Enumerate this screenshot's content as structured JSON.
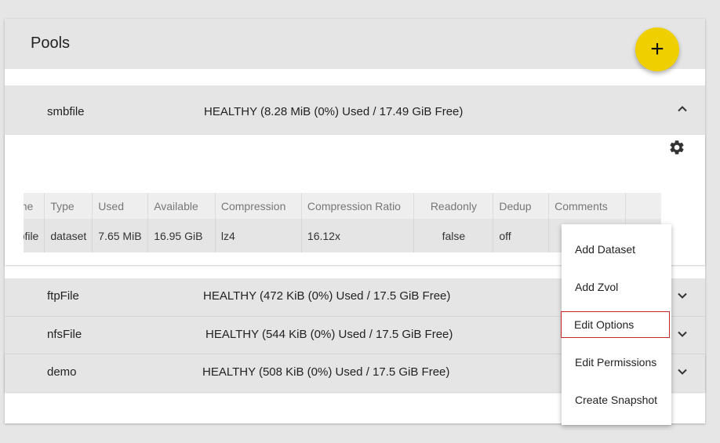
{
  "page": {
    "title": "Pools"
  },
  "fab": {
    "label": "+"
  },
  "pools": [
    {
      "name": "smbfile",
      "status": "HEALTHY (8.28 MiB (0%) Used / 17.49 GiB Free)",
      "expanded": true
    },
    {
      "name": "ftpFile",
      "status": "HEALTHY (472 KiB (0%) Used / 17.5 GiB Free)",
      "expanded": false
    },
    {
      "name": "nfsFile",
      "status": "HEALTHY (544 KiB (0%) Used / 17.5 GiB Free)",
      "expanded": false
    },
    {
      "name": "demo",
      "status": "HEALTHY (508 KiB (0%) Used / 17.5 GiB Free)",
      "expanded": false
    }
  ],
  "table": {
    "headers": [
      "Name",
      "Type",
      "Used",
      "Available",
      "Compression",
      "Compression Ratio",
      "Readonly",
      "Dedup",
      "Comments"
    ],
    "rows": [
      [
        "smbfile",
        "dataset",
        "7.65 MiB",
        "16.95 GiB",
        "lz4",
        "16.12x",
        "false",
        "off",
        ""
      ]
    ]
  },
  "menu": {
    "items": [
      "Add Dataset",
      "Add Zvol",
      "Edit Options",
      "Edit Permissions",
      "Create Snapshot"
    ],
    "focused": "Edit Options"
  },
  "colors": {
    "accent": "#f0cf00",
    "focus": "#c62828",
    "row_bg": "#e5e5e5"
  },
  "icons": {
    "expanded": "chevron-up-icon",
    "collapsed": "chevron-down-icon",
    "settings": "gear-icon"
  }
}
